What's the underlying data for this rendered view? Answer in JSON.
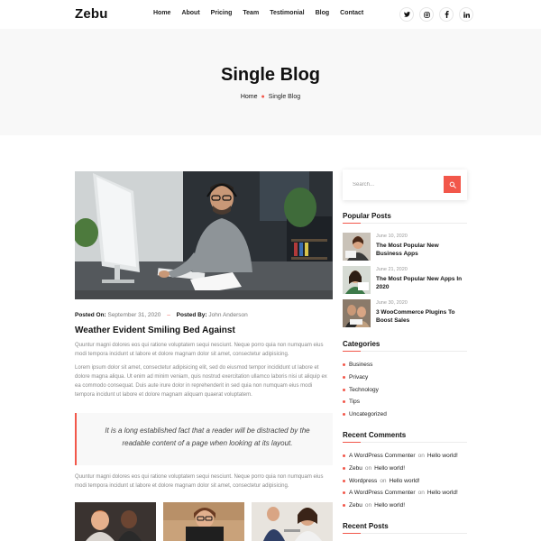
{
  "header": {
    "logo": "Zebu",
    "nav": [
      "Home",
      "About",
      "Pricing",
      "Team",
      "Testimonial",
      "Blog",
      "Contact"
    ],
    "socials": [
      {
        "label": "t",
        "icon": "twitter-icon"
      },
      {
        "label": "ig",
        "icon": "instagram-icon"
      },
      {
        "label": "f",
        "icon": "facebook-icon"
      },
      {
        "label": "in",
        "icon": "linkedin-icon"
      }
    ]
  },
  "banner": {
    "title": "Single Blog",
    "breadcrumb_home": "Home",
    "breadcrumb_current": "Single Blog"
  },
  "post": {
    "posted_on_label": "Posted On:",
    "posted_on_value": "September 31, 2020",
    "posted_by_label": "Posted By:",
    "posted_by_value": "John Anderson",
    "title": "Weather Evident Smiling Bed Against",
    "para1": "Quuntur magni dolores eos qui ratione voluptatem sequi nesciunt. Neque porro quia non numquam eius modi tempora incidunt ut labore et dolore magnam dolor sit amet, consectetur adipisicing.",
    "para2": "Lorem ipsum dolor sit amet, consectetur adipisicing elit, sed do eiusmod tempor incididunt ut labore et dolore magna aliqua. Ut enim ad minim veniam, quis nostrud exercitation ullamco laboris nisi ut aliquip ex ea commodo consequat. Duis aute irure dolor in reprehenderit in sed quia non numquam eius modi tempora incidunt ut labore et dolore magnam aliquam quaerat voluptatem.",
    "quote": "It is a long established fact that a reader will be distracted by the readable content of a page when looking at its layout.",
    "para3": "Quuntur magni dolores eos qui ratione voluptatem sequi nesciunt. Neque porro quia non numquam eius modi tempora incidunt ut labore et dolore magnam dolor sit amet, consectetur adipisicing."
  },
  "sidebar": {
    "search_placeholder": "Search...",
    "popular_heading": "Popular Posts",
    "popular": [
      {
        "date": "June 10, 2020",
        "title": "The Most Popular New Business Apps"
      },
      {
        "date": "June 21, 2020",
        "title": "The Most Popular New Apps In 2020"
      },
      {
        "date": "June 30, 2020",
        "title": "3 WooCommerce Plugins To Boost Sales"
      }
    ],
    "categories_heading": "Categories",
    "categories": [
      "Business",
      "Privacy",
      "Technology",
      "Tips",
      "Uncategorized"
    ],
    "comments_heading": "Recent Comments",
    "comments": [
      {
        "author": "A WordPress Commenter",
        "on": "on",
        "post": "Hello world!"
      },
      {
        "author": "Zebu",
        "on": "on",
        "post": "Hello world!"
      },
      {
        "author": "Wordpress",
        "on": "on",
        "post": "Hello world!"
      },
      {
        "author": "A WordPress Commenter",
        "on": "on",
        "post": "Hello world!"
      },
      {
        "author": "Zebu",
        "on": "on",
        "post": "Hello world!"
      }
    ],
    "recent_heading": "Recent Posts"
  },
  "colors": {
    "accent": "#f2574a",
    "banner_bg": "#f8f8f8"
  }
}
